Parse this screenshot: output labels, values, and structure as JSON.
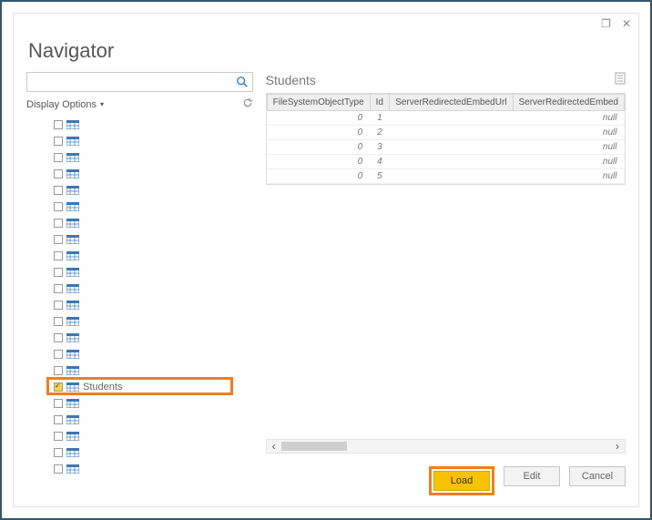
{
  "window": {
    "title": "Navigator",
    "restore_glyph": "❐",
    "close_glyph": "✕"
  },
  "left": {
    "search_placeholder": "",
    "display_options_label": "Display Options",
    "items": [
      {
        "label": "",
        "checked": false
      },
      {
        "label": "",
        "checked": false
      },
      {
        "label": "",
        "checked": false
      },
      {
        "label": "",
        "checked": false
      },
      {
        "label": "",
        "checked": false
      },
      {
        "label": "",
        "checked": false
      },
      {
        "label": "",
        "checked": false
      },
      {
        "label": "",
        "checked": false
      },
      {
        "label": "",
        "checked": false
      },
      {
        "label": "",
        "checked": false
      },
      {
        "label": "",
        "checked": false
      },
      {
        "label": "",
        "checked": false
      },
      {
        "label": "",
        "checked": false
      },
      {
        "label": "",
        "checked": false
      },
      {
        "label": "",
        "checked": false
      },
      {
        "label": "",
        "checked": false
      },
      {
        "label": "Students",
        "checked": true
      },
      {
        "label": "",
        "checked": false
      },
      {
        "label": "",
        "checked": false
      },
      {
        "label": "",
        "checked": false
      },
      {
        "label": "",
        "checked": false
      },
      {
        "label": "",
        "checked": false
      }
    ]
  },
  "preview": {
    "title": "Students",
    "columns": [
      "FileSystemObjectType",
      "Id",
      "ServerRedirectedEmbedUrl",
      "ServerRedirectedEmbed"
    ],
    "rows": [
      {
        "FileSystemObjectType": "0",
        "Id": "1",
        "ServerRedirectedEmbedUrl": "",
        "ServerRedirectedEmbed": "null"
      },
      {
        "FileSystemObjectType": "0",
        "Id": "2",
        "ServerRedirectedEmbedUrl": "",
        "ServerRedirectedEmbed": "null"
      },
      {
        "FileSystemObjectType": "0",
        "Id": "3",
        "ServerRedirectedEmbedUrl": "",
        "ServerRedirectedEmbed": "null"
      },
      {
        "FileSystemObjectType": "0",
        "Id": "4",
        "ServerRedirectedEmbedUrl": "",
        "ServerRedirectedEmbed": "null"
      },
      {
        "FileSystemObjectType": "0",
        "Id": "5",
        "ServerRedirectedEmbedUrl": "",
        "ServerRedirectedEmbed": "null"
      }
    ]
  },
  "buttons": {
    "load": "Load",
    "edit": "Edit",
    "cancel": "Cancel"
  }
}
